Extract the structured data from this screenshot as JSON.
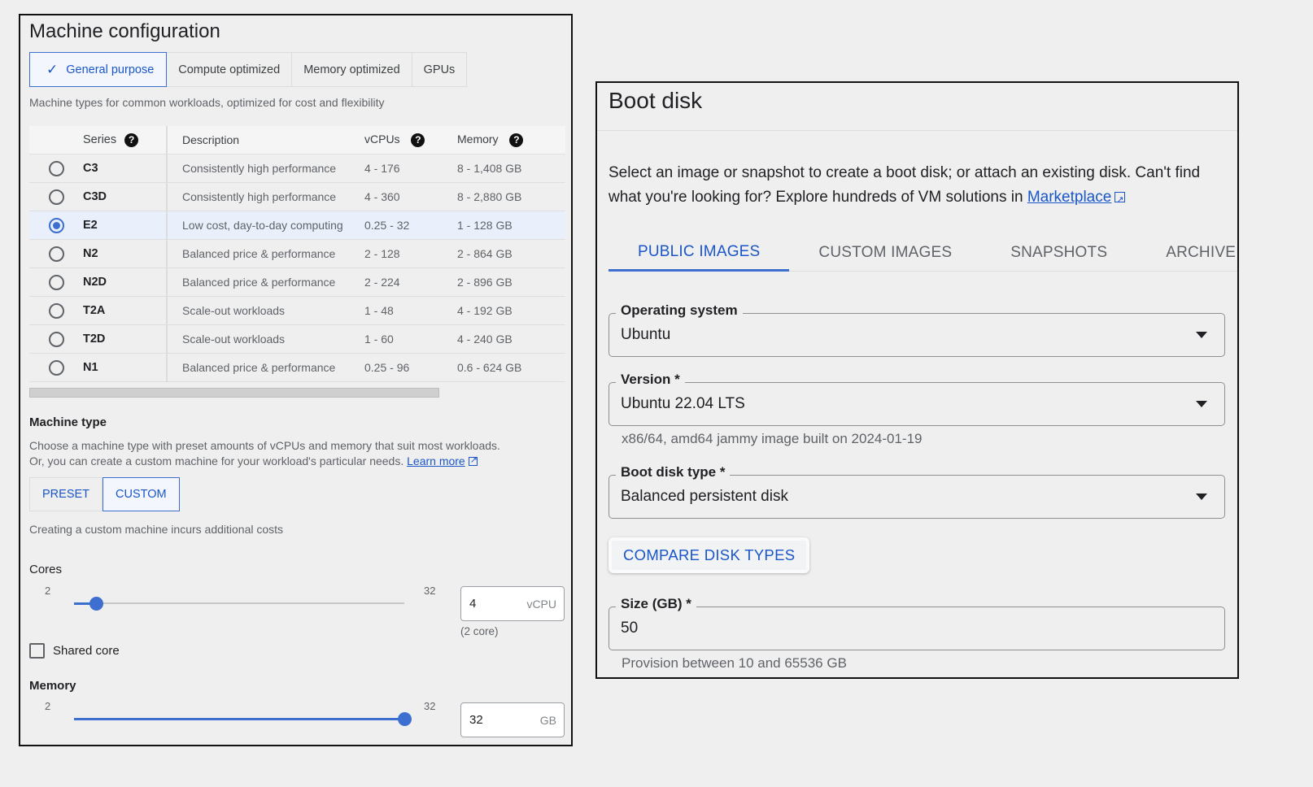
{
  "machine_config": {
    "title": "Machine configuration",
    "tabs": [
      {
        "label": "General purpose",
        "active": true
      },
      {
        "label": "Compute optimized",
        "active": false
      },
      {
        "label": "Memory optimized",
        "active": false
      },
      {
        "label": "GPUs",
        "active": false
      }
    ],
    "subtitle": "Machine types for common workloads, optimized for cost and flexibility",
    "table": {
      "headers": {
        "series": "Series",
        "description": "Description",
        "vcpus": "vCPUs",
        "memory": "Memory"
      },
      "rows": [
        {
          "series": "C3",
          "description": "Consistently high performance",
          "vcpus": "4 - 176",
          "memory": "8 - 1,408 GB",
          "selected": false
        },
        {
          "series": "C3D",
          "description": "Consistently high performance",
          "vcpus": "4 - 360",
          "memory": "8 - 2,880 GB",
          "selected": false
        },
        {
          "series": "E2",
          "description": "Low cost, day-to-day computing",
          "vcpus": "0.25 - 32",
          "memory": "1 - 128 GB",
          "selected": true
        },
        {
          "series": "N2",
          "description": "Balanced price & performance",
          "vcpus": "2 - 128",
          "memory": "2 - 864 GB",
          "selected": false
        },
        {
          "series": "N2D",
          "description": "Balanced price & performance",
          "vcpus": "2 - 224",
          "memory": "2 - 896 GB",
          "selected": false
        },
        {
          "series": "T2A",
          "description": "Scale-out workloads",
          "vcpus": "1 - 48",
          "memory": "4 - 192 GB",
          "selected": false
        },
        {
          "series": "T2D",
          "description": "Scale-out workloads",
          "vcpus": "1 - 60",
          "memory": "4 - 240 GB",
          "selected": false
        },
        {
          "series": "N1",
          "description": "Balanced price & performance",
          "vcpus": "0.25 - 96",
          "memory": "0.6 - 624 GB",
          "selected": false
        }
      ]
    },
    "machine_type": {
      "title": "Machine type",
      "desc_line1": "Choose a machine type with preset amounts of vCPUs and memory that suit most workloads.",
      "desc_line2": "Or, you can create a custom machine for your workload's particular needs.",
      "learn_more": "Learn more",
      "preset_label": "PRESET",
      "custom_label": "CUSTOM",
      "selected_mode": "CUSTOM",
      "custom_note": "Creating a custom machine incurs additional costs"
    },
    "cores": {
      "label": "Cores",
      "min": "2",
      "max": "32",
      "value": "4",
      "unit": "vCPU",
      "hint": "(2 core)",
      "slider_fraction": 0.0667
    },
    "shared_core": {
      "label": "Shared core",
      "checked": false
    },
    "memory": {
      "label": "Memory",
      "min": "2",
      "max": "32",
      "value": "32",
      "unit": "GB",
      "slider_fraction": 1.0
    }
  },
  "boot_disk": {
    "title": "Boot disk",
    "description": "Select an image or snapshot to create a boot disk; or attach an existing disk. Can't find what you're looking for? Explore hundreds of VM solutions in",
    "marketplace_link": "Marketplace",
    "tabs": [
      {
        "label": "PUBLIC IMAGES",
        "active": true
      },
      {
        "label": "CUSTOM IMAGES",
        "active": false
      },
      {
        "label": "SNAPSHOTS",
        "active": false
      },
      {
        "label": "ARCHIVE SNA",
        "active": false
      }
    ],
    "os": {
      "label": "Operating system",
      "value": "Ubuntu"
    },
    "version": {
      "label": "Version *",
      "value": "Ubuntu 22.04 LTS",
      "hint": "x86/64, amd64 jammy image built on 2024-01-19"
    },
    "disk_type": {
      "label": "Boot disk type *",
      "value": "Balanced persistent disk"
    },
    "compare_button": "COMPARE DISK TYPES",
    "size": {
      "label": "Size (GB) *",
      "value": "50",
      "hint": "Provision between 10 and 65536 GB"
    }
  },
  "colors": {
    "accent": "#3c6fd0",
    "link": "#1a56c9",
    "border": "#111111"
  }
}
